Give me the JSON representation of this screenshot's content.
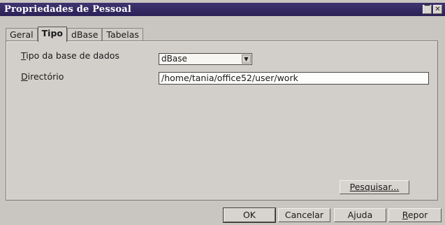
{
  "window": {
    "title": "Propriedades de Pessoal",
    "min_glyph": "▔",
    "close_glyph": "✕"
  },
  "tabs": [
    {
      "label": "Geral",
      "active": false
    },
    {
      "label": "Tipo",
      "active": true
    },
    {
      "label": "dBase",
      "active": false
    },
    {
      "label": "Tabelas",
      "active": false
    }
  ],
  "form": {
    "db_type_label_first": "T",
    "db_type_label_rest": "ipo da base de dados",
    "db_type_value": "dBase",
    "dropdown_glyph": "▼",
    "dir_label_first": "D",
    "dir_label_rest": "irectório",
    "dir_value": "/home/tania/office52/user/work"
  },
  "buttons": {
    "browse": "Pesquisar...",
    "ok": "OK",
    "cancel": "Cancelar",
    "help_pre": "A",
    "help_u": "j",
    "help_post": "uda",
    "reset_u": "R",
    "reset_post": "epor"
  }
}
